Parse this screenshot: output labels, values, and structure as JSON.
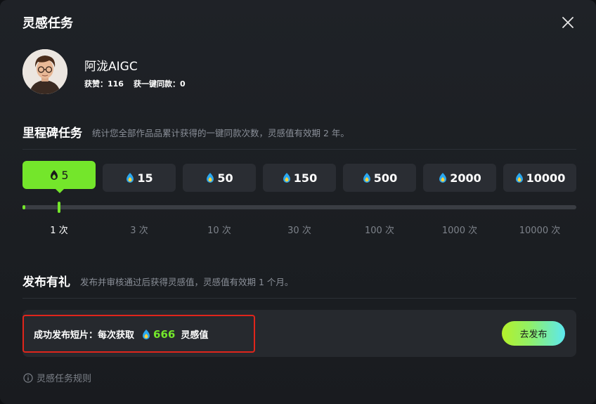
{
  "dialog": {
    "title": "灵感任务"
  },
  "user": {
    "name": "阿泷AIGC",
    "likes": "获赞：116",
    "copies": "获一键同款：0"
  },
  "milestone": {
    "title": "里程碑任务",
    "desc": "统计您全部作品品累计获得的一键同款次数，灵感值有效期 2 年。",
    "tiers": [
      "5",
      "15",
      "50",
      "150",
      "500",
      "2000",
      "10000"
    ],
    "counts": [
      "1 次",
      "3 次",
      "10 次",
      "30 次",
      "100 次",
      "1000 次",
      "10000 次"
    ],
    "active_index": 0
  },
  "publish": {
    "title": "发布有礼",
    "desc": "发布并审核通过后获得灵感值，灵感值有效期 1 个月。",
    "reward_prefix": "成功发布短片：每次获取",
    "reward_amount": "666",
    "reward_suffix": "灵感值",
    "button": "去发布"
  },
  "rules_link": "灵感任务规则",
  "colors": {
    "accent": "#74e62b",
    "highlight": "#e0251b"
  },
  "icons": {
    "close": "close-icon",
    "drop": "flame-drop-icon",
    "info": "info-circle-icon"
  }
}
